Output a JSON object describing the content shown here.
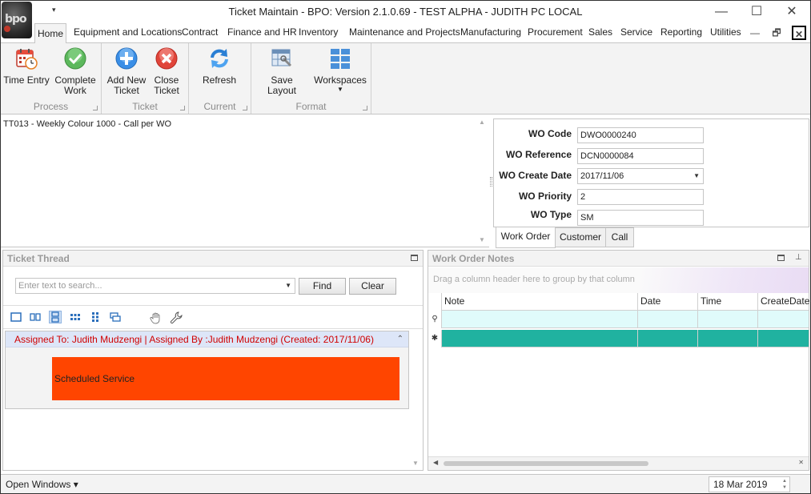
{
  "app": {
    "logo_text": "bpo",
    "title": "Ticket Maintain - BPO: Version 2.1.0.69 - TEST ALPHA - JUDITH PC LOCAL",
    "qa_dropdown": "▾",
    "window_controls": {
      "minimize": "—",
      "maximize": "☐",
      "close": "✕"
    },
    "mdi_controls": {
      "minimize": "—",
      "restore": "🗗",
      "close": "✕"
    }
  },
  "menu_tabs": [
    "Home",
    "Equipment and Locations",
    "Contract",
    "Finance and HR",
    "Inventory",
    "Maintenance and Projects",
    "Manufacturing",
    "Procurement",
    "Sales",
    "Service",
    "Reporting",
    "Utilities"
  ],
  "ribbon": {
    "groups": [
      {
        "label": "Process",
        "buttons": [
          {
            "label": "Time Entry",
            "icon": "calendar-clock-icon"
          },
          {
            "label": "Complete Work",
            "icon": "green-check-icon"
          }
        ]
      },
      {
        "label": "Ticket",
        "buttons": [
          {
            "label": "Add New Ticket",
            "icon": "blue-plus-icon"
          },
          {
            "label": "Close Ticket",
            "icon": "red-x-icon"
          }
        ]
      },
      {
        "label": "Current",
        "buttons": [
          {
            "label": "Refresh",
            "icon": "refresh-icon"
          }
        ]
      },
      {
        "label": "Format",
        "buttons": [
          {
            "label": "Save Layout",
            "icon": "save-layout-icon"
          },
          {
            "label": "Workspaces",
            "icon": "workspaces-icon"
          }
        ]
      }
    ]
  },
  "description": "TT013 - Weekly Colour 1000 - Call per WO",
  "work_order": {
    "fields": [
      {
        "label": "WO Code",
        "value": "DWO0000240"
      },
      {
        "label": "WO Reference",
        "value": "DCN0000084"
      },
      {
        "label": "WO Create Date",
        "value": "2017/11/06"
      },
      {
        "label": "WO Priority",
        "value": "2"
      },
      {
        "label": "WO Type",
        "value": "SM"
      }
    ],
    "tabs": [
      "Work Order",
      "Customer",
      "Call"
    ],
    "active_tab": "Work Order"
  },
  "ticket_thread": {
    "title": "Ticket Thread",
    "search_placeholder": "Enter text to search...",
    "find_label": "Find",
    "clear_label": "Clear",
    "assigned_text": "Assigned To: Judith Mudzengi | Assigned By :Judith Mudzengi (Created: 2017/11/06)",
    "card_text": "Scheduled Service",
    "card_color": "#ff4500"
  },
  "work_order_notes": {
    "title": "Work Order Notes",
    "group_hint": "Drag a column header here to group by that column",
    "columns": [
      "Note",
      "Date",
      "Time",
      "CreateDate"
    ],
    "filter_row_color": "#e0fbfb",
    "new_row_color": "#20b2a0"
  },
  "status_bar": {
    "open_windows": "Open Windows ▾",
    "date": "18 Mar 2019"
  }
}
